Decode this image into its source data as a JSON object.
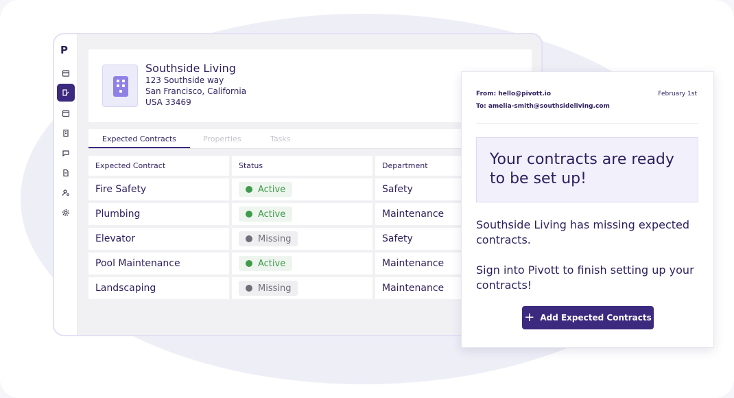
{
  "app": {
    "brand_letter": "P",
    "nav_icons": [
      "inbox-icon",
      "contract-edit-icon",
      "calendar-icon",
      "building-icon",
      "chat-icon",
      "document-icon",
      "user-settings-icon",
      "gear-icon"
    ],
    "active_nav": "contract-edit-icon"
  },
  "property": {
    "name": "Southside Living",
    "street": "123 Southside way",
    "city": "San Francisco, California",
    "country_zip": "USA 33469"
  },
  "tabs": [
    {
      "label": "Expected Contracts",
      "active": true
    },
    {
      "label": "Properties",
      "active": false
    },
    {
      "label": "Tasks",
      "active": false
    }
  ],
  "table": {
    "headers": [
      "Expected Contract",
      "Status",
      "Department"
    ],
    "rows": [
      {
        "contract": "Fire Safety",
        "status": "Active",
        "department": "Safety"
      },
      {
        "contract": "Plumbing",
        "status": "Active",
        "department": "Maintenance"
      },
      {
        "contract": "Elevator",
        "status": "Missing",
        "department": "Safety"
      },
      {
        "contract": "Pool Maintenance",
        "status": "Active",
        "department": "Maintenance"
      },
      {
        "contract": "Landscaping",
        "status": "Missing",
        "department": "Maintenance"
      }
    ]
  },
  "email": {
    "from": "From: hello@pivott.io",
    "to": "To: amelia-smith@southsideliving.com",
    "date": "February 1st",
    "headline": "Your contracts are ready to be set up!",
    "body1": "Southside Living has missing expected contracts.",
    "body2": "Sign into Pivott to finish setting up your contracts!",
    "cta": "Add Expected Contracts"
  },
  "colors": {
    "brand": "#3b2a7e",
    "text": "#2d1f5e",
    "active": "#3f9b4c",
    "missing": "#6f6f79"
  }
}
